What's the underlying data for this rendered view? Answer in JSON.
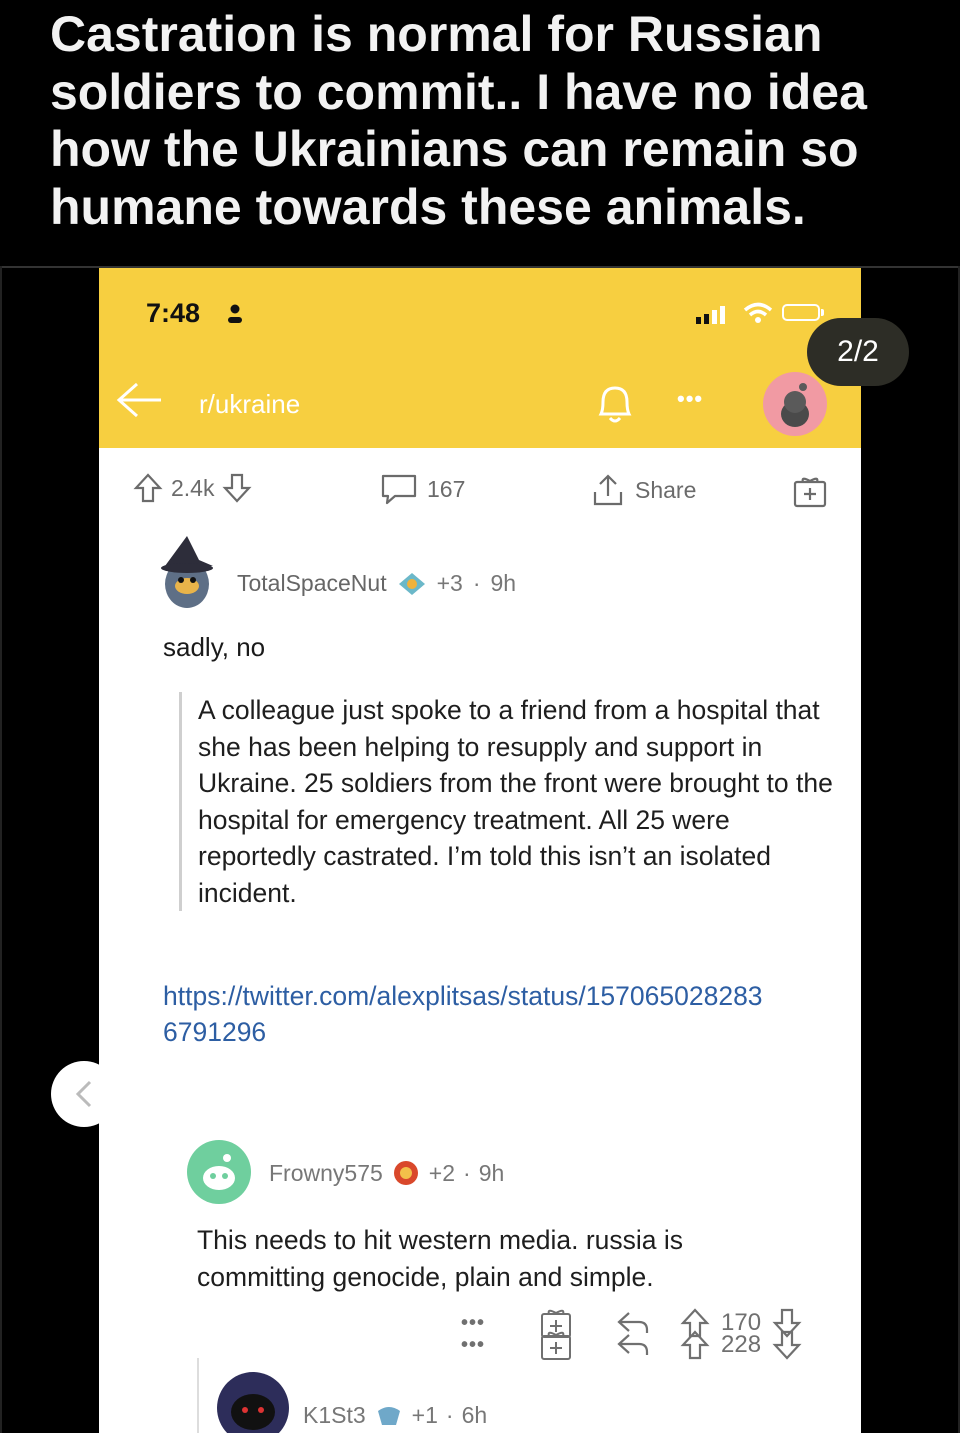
{
  "post": {
    "title": "Castration is normal for Russian soldiers to commit.. I have no idea how the Ukrainians can remain so humane towards these animals."
  },
  "gallery": {
    "counter": "2/2",
    "prev_icon": "chevron-left-icon"
  },
  "screenshot": {
    "status_bar": {
      "time": "7:48"
    },
    "header": {
      "subreddit": "r/ukraine"
    },
    "actions": {
      "upvotes": "2.4k",
      "comments": "167",
      "share_label": "Share"
    },
    "comments": [
      {
        "username": "TotalSpaceNut",
        "awards": "+3",
        "age": "9h",
        "text": "sadly, no",
        "quote": "A colleague just spoke to a friend from a hospital that she has been helping to resupply and support in Ukraine. 25 soldiers from the front were brought to the hospital for emergency treatment. All 25 were reportedly castrated. I’m told this isn’t an isolated incident.",
        "link": "https://twitter.com/alexplitsas/status/1570650282836791296",
        "score": "228"
      },
      {
        "username": "Frowny575",
        "awards": "+2",
        "age": "9h",
        "text": "This needs to hit western media. russia is committing genocide, plain and simple.",
        "score": "170"
      },
      {
        "username": "K1St3",
        "awards": "+1",
        "age": "6h"
      }
    ],
    "colors": {
      "header_bg": "#f7cf40",
      "link": "#2d5ea3"
    }
  }
}
